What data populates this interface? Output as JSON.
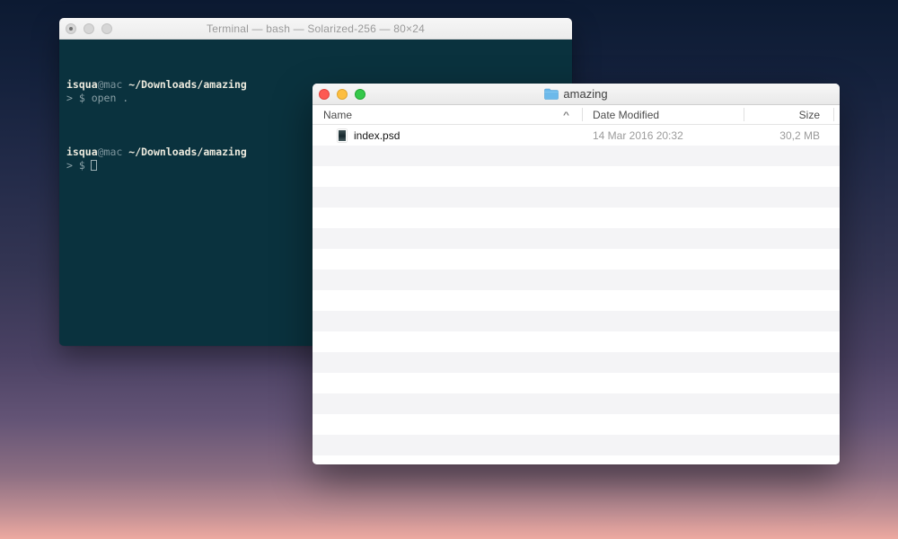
{
  "colors": {
    "terminal_bg": "#0a323e",
    "terminal_text_bright": "#eceade",
    "terminal_text_muted": "#7d959d",
    "folder_blue": "#6cb9ea",
    "traffic_red": "#fd5952",
    "traffic_yellow": "#fdbe40",
    "traffic_green": "#35c84a",
    "desktop_top": "#0c1a32",
    "desktop_bottom": "#eda9a0"
  },
  "terminal": {
    "title": "Terminal — bash — Solarized-256 — 80×24",
    "blocks": [
      {
        "user": "isqua",
        "host": "@mac",
        "path": "~/Downloads/amazing",
        "command": "> $ open ."
      },
      {
        "user": "isqua",
        "host": "@mac",
        "path": "~/Downloads/amazing",
        "prompt": "> $"
      }
    ]
  },
  "finder": {
    "title": "amazing",
    "columns": {
      "name": "Name",
      "date_modified": "Date Modified",
      "size": "Size"
    },
    "sort_indicator": "^",
    "files": [
      {
        "name": "index.psd",
        "date_modified": "14 Mar 2016 20:32",
        "size": "30,2 MB"
      }
    ]
  }
}
